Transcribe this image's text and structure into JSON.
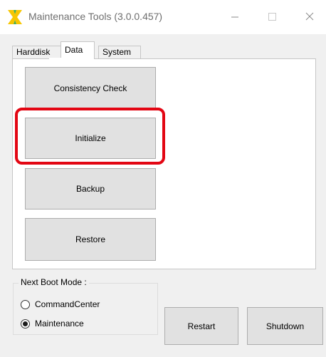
{
  "window": {
    "title": "Maintenance Tools (3.0.0.457)",
    "icon": "app-icon",
    "controls": {
      "minimize_icon": "minimize-icon",
      "maximize_icon": "maximize-icon",
      "close_icon": "close-icon"
    }
  },
  "tabs": [
    {
      "label": "Harddisk",
      "active": false
    },
    {
      "label": "Data",
      "active": true
    },
    {
      "label": "System",
      "active": false
    }
  ],
  "data_tab": {
    "buttons": {
      "consistency_check": "Consistency Check",
      "initialize": "Initialize",
      "backup": "Backup",
      "restore": "Restore"
    },
    "highlighted_button": "Initialize",
    "highlight_color": "#e30613"
  },
  "boot_mode": {
    "legend": "Next Boot Mode :",
    "options": [
      {
        "label": "CommandCenter",
        "selected": false
      },
      {
        "label": "Maintenance",
        "selected": true
      }
    ]
  },
  "footer_buttons": {
    "restart": "Restart",
    "shutdown": "Shutdown"
  }
}
